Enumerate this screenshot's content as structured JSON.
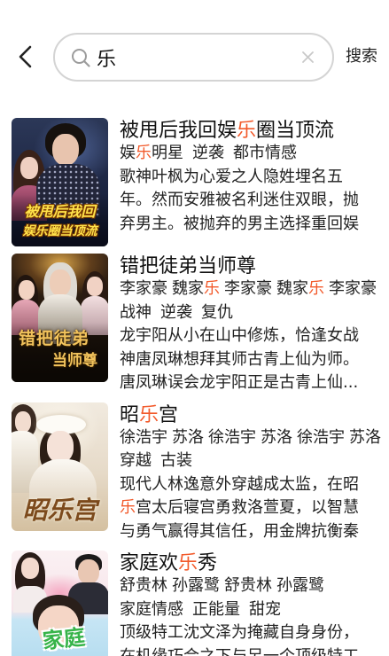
{
  "header": {
    "back_icon": "chevron-left-icon",
    "search": {
      "query": "乐",
      "search_icon": "search-icon",
      "clear_icon": "close-icon"
    },
    "search_button_label": "搜索"
  },
  "colors": {
    "keyword_highlight": "#f25a2b",
    "search_border": "#d4d4d4"
  },
  "results": [
    {
      "title": "被甩后我回娱乐圈当顶流",
      "tags": [
        "娱乐明星",
        "逆袭",
        "都市情感"
      ],
      "description": "歌神叶枫为心爱之人隐姓埋名五年。然而安雅被名利迷住双眼，抛弃男主。被抛弃的男主选择重回娱",
      "cover_text": [
        "被甩后我回",
        "娱乐圈当顶流"
      ]
    },
    {
      "title": "错把徒弟当师尊",
      "cast": [
        "李家豪",
        "魏家乐",
        "李家豪",
        "魏家乐",
        "李家豪"
      ],
      "tags": [
        "战神",
        "逆袭",
        "复仇"
      ],
      "description": "龙宇阳从小在山中修炼，恰逢女战神唐凤琳想拜其师古青上仙为师。唐凤琳误会龙宇阳正是古青上仙...",
      "cover_text": [
        "错把徒弟",
        "当师尊"
      ]
    },
    {
      "title": "昭乐宫",
      "cast": [
        "徐浩宇",
        "苏洛",
        "徐浩宇",
        "苏洛",
        "徐浩宇",
        "苏洛"
      ],
      "tags": [
        "穿越",
        "古装"
      ],
      "description": "现代人林逸意外穿越成太监，在昭乐宫太后寝宫勇救洛萱夏，以智慧与勇气赢得其信任，用金牌抗衡秦",
      "cover_text": [
        "昭乐宫"
      ]
    },
    {
      "title": "家庭欢乐秀",
      "cast": [
        "舒贵林",
        "孙露鹭",
        "舒贵林",
        "孙露鹭"
      ],
      "tags": [
        "家庭情感",
        "正能量",
        "甜宠"
      ],
      "description": "顶级特工沈文泽为掩藏自身身份，在机缘巧合之下与另一个顶级特工",
      "cover_text": [
        "家庭"
      ]
    }
  ]
}
